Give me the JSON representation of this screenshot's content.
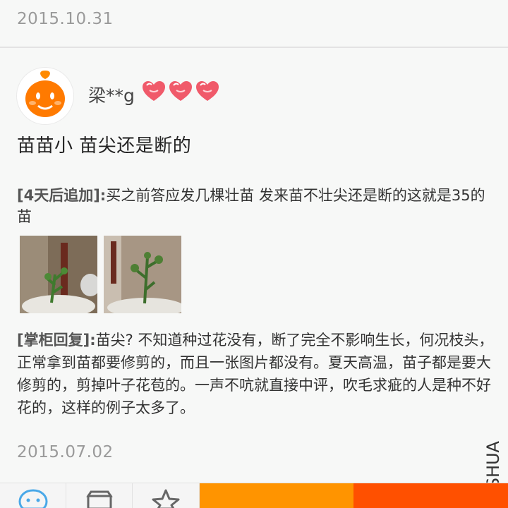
{
  "review": {
    "date": "2015.10.31",
    "user_name": "梁**g",
    "reputation_icons": [
      "heart-icon",
      "heart-icon",
      "heart-icon"
    ],
    "text": "苗苗小  苗尖还是断的",
    "followup": {
      "tag": "[4天后追加]:",
      "text": "买之前答应发几棵壮苗  发来苗不壮尖还是断的这就是35的苗"
    },
    "photos": [
      "photo-seedling-1",
      "photo-seedling-2"
    ],
    "seller_reply": {
      "tag": "[掌柜回复]:",
      "text": "苗尖? 不知道种过花没有，断了完全不影响生长，何况枝头，正常拿到苗都要修剪的，而且一张图片都没有。夏天高温，苗子都是要大修剪的，剪掉叶子花苞的。一声不吭就直接中评，吹毛求疵的人是种不好花的，这样的例子太多了。"
    },
    "purchase_date": "2015.07.02"
  },
  "watermark": "MSHUA",
  "toolbar": {
    "icons": [
      "chat-icon",
      "shop-icon",
      "star-icon"
    ],
    "colors": {
      "cart": "#ff9400",
      "buy": "#ff5000"
    }
  }
}
